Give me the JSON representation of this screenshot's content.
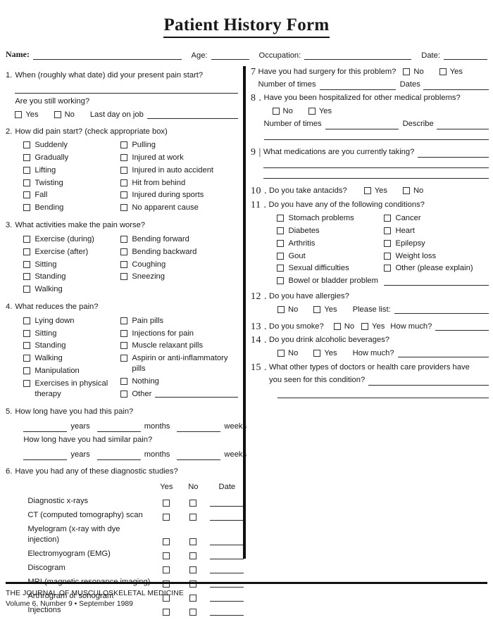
{
  "title": "Patient History Form",
  "identity": {
    "name_label": "Name:",
    "age_label": "Age:",
    "occupation_label": "Occupation:",
    "date_label": "Date:",
    "name_value": "",
    "age_value": "",
    "occupation_value": "",
    "date_value": ""
  },
  "common": {
    "yes": "Yes",
    "no": "No",
    "date": "Date",
    "other": "Other",
    "how_much": "How much?",
    "number_of_times": "Number of times",
    "dates": "Dates",
    "describe": "Describe",
    "please_list": "Please list:",
    "years": "years",
    "months": "months",
    "weeks": "weeks"
  },
  "left": {
    "q1": {
      "num": "1.",
      "text": "When (roughly what date) did your present pain start?",
      "still_working": "Are you still working?",
      "last_day_label": "Last day on job",
      "yes": "Yes",
      "no": "No"
    },
    "q2": {
      "num": "2.",
      "text": "How did pain start? (check appropriate box)",
      "col_a": [
        "Suddenly",
        "Gradually",
        "Lifting",
        "Twisting",
        "Fall",
        "Bending"
      ],
      "col_b": [
        "Pulling",
        "Injured at work",
        "Injured in auto accident",
        "Hit from behind",
        "Injured during sports",
        "No apparent cause"
      ]
    },
    "q3": {
      "num": "3.",
      "text": "What activities make the pain worse?",
      "col_a": [
        "Exercise (during)",
        "Exercise (after)",
        "Sitting",
        "Standing",
        "Walking"
      ],
      "col_b": [
        "Bending forward",
        "Bending backward",
        "Coughing",
        "Sneezing"
      ]
    },
    "q4": {
      "num": "4.",
      "text": "What reduces the pain?",
      "col_a": [
        "Lying down",
        "Sitting",
        "Standing",
        "Walking",
        "Manipulation",
        "Exercises in physical therapy"
      ],
      "col_b": [
        "Pain pills",
        "Injections for pain",
        "Muscle relaxant pills",
        "Aspirin or anti-inflammatory pills",
        "Nothing"
      ],
      "other_label": "Other"
    },
    "q5": {
      "num": "5.",
      "text": "How long have you had this pain?",
      "text2": "How long have you had similar pain?"
    },
    "q6": {
      "num": "6.",
      "text": "Have you had any of these diagnostic studies?",
      "headers": [
        "Yes",
        "No",
        "Date"
      ],
      "rows": [
        "Diagnostic x-rays",
        "CT (computed tomography) scan",
        "Myelogram (x-ray with dye injection)",
        "Electromyogram (EMG)",
        "Discogram",
        "MRI (magnetic resonance imaging)",
        "Arthrogram or sonogram",
        "Injections"
      ]
    }
  },
  "right": {
    "q7": {
      "num": "7",
      "text": "Have you had surgery for this problem?",
      "no": "No",
      "yes": "Yes",
      "times_label": "Number of times",
      "dates_label": "Dates"
    },
    "q8": {
      "num": "8 .",
      "text": "Have you been hospitalized for other medical problems?",
      "no": "No",
      "yes": "Yes",
      "times_label": "Number of times",
      "describe_label": "Describe"
    },
    "q9": {
      "num": "9 |",
      "text": "What medications are you currently taking?"
    },
    "q10": {
      "num": "10 .",
      "text": "Do you take antacids?",
      "yes": "Yes",
      "no": "No"
    },
    "q11": {
      "num": "11 .",
      "text": "Do you have any of the following conditions?",
      "col_a": [
        "Stomach problems",
        "Diabetes",
        "Arthritis",
        "Gout",
        "Sexual difficulties",
        "Bowel or bladder problem"
      ],
      "col_b": [
        "Cancer",
        "Heart",
        "Epilepsy",
        "Weight loss",
        "Other (please explain)"
      ]
    },
    "q12": {
      "num": "12 .",
      "text": "Do you have allergies?",
      "no": "No",
      "yes": "Yes",
      "list_label": "Please list:"
    },
    "q13": {
      "num": "13 .",
      "text": "Do you smoke?",
      "no": "No",
      "yes": "Yes",
      "how_much": "How much?"
    },
    "q14": {
      "num": "14 .",
      "text": "Do you drink alcoholic beverages?",
      "no": "No",
      "yes": "Yes",
      "how_much": "How much?"
    },
    "q15": {
      "num": "15 .",
      "text": "What other types of doctors or health care providers have",
      "text2": "you seen for this condition?"
    }
  },
  "footer": {
    "line1": "THE JOURNAL OF MUSCULOSKELETAL MEDICINE",
    "line2": "Volume 6, Number 9 • September 1989"
  }
}
